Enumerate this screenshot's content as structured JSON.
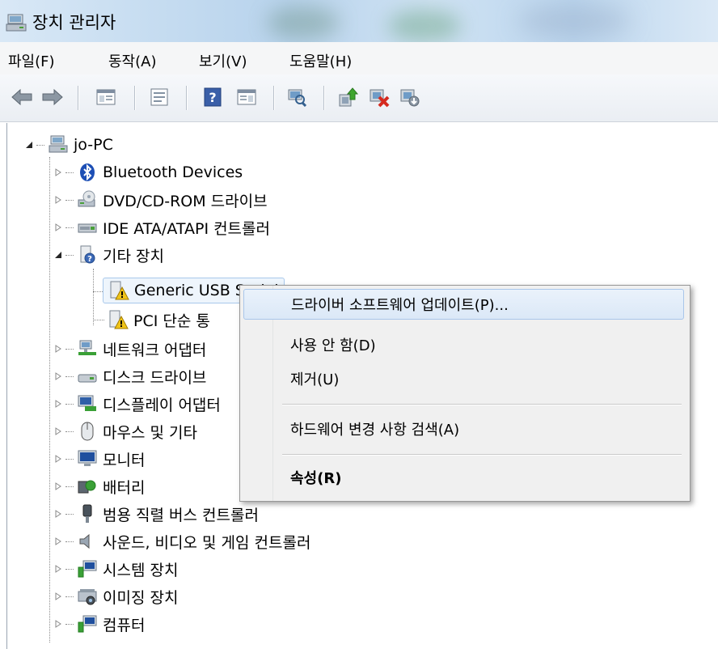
{
  "window": {
    "title": "장치 관리자"
  },
  "menubar": {
    "items": [
      "파일(F)",
      "동작(A)",
      "보기(V)",
      "도움말(H)"
    ]
  },
  "toolbar": {
    "icons": [
      "back-arrow-icon",
      "forward-arrow-icon",
      "console-tree-icon",
      "properties-icon",
      "help-icon",
      "action-pane-icon",
      "scan-hardware-icon",
      "update-driver-icon",
      "uninstall-icon",
      "disable-icon"
    ]
  },
  "tree": {
    "root": "jo-PC",
    "categories": [
      "Bluetooth Devices",
      "DVD/CD-ROM 드라이브",
      "IDE ATA/ATAPI 컨트롤러",
      "기타 장치",
      "네트워크 어댑터",
      "디스크 드라이브",
      "디스플레이 어댑터",
      "마우스 및 기타",
      "모니터",
      "배터리",
      "범용 직렬 버스 컨트롤러",
      "사운드, 비디오 및 게임 컨트롤러",
      "시스템 장치",
      "이미징 장치",
      "컴퓨터"
    ],
    "other_devices_children": [
      "Generic USB Serial",
      "PCI 단순 통"
    ]
  },
  "context_menu": {
    "update_driver": "드라이버 소프트웨어 업데이트(P)...",
    "disable": "사용 안 함(D)",
    "uninstall": "제거(U)",
    "scan": "하드웨어 변경 사항 검색(A)",
    "properties": "속성(R)"
  },
  "colors": {
    "selection": "#a8c8eb",
    "warning": "#f0c419"
  }
}
